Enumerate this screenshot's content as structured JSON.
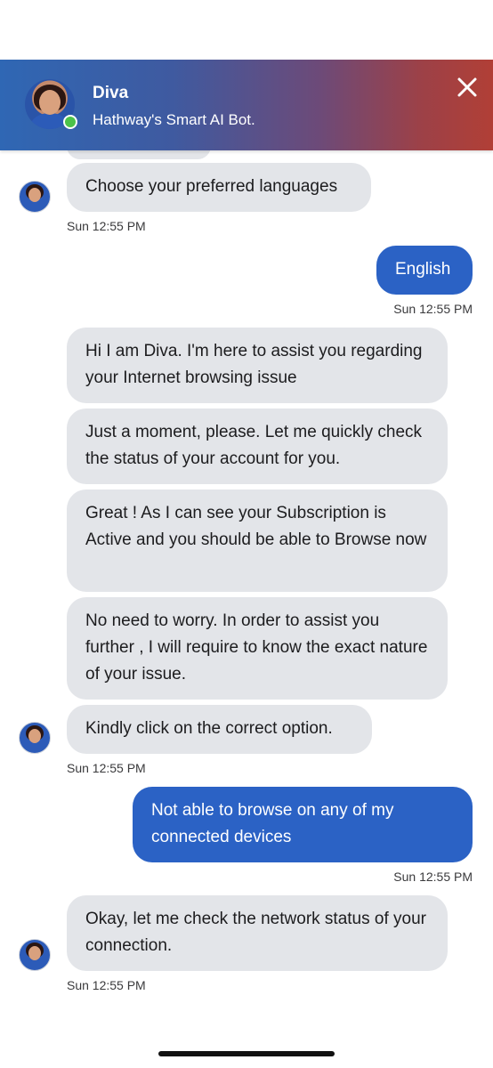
{
  "header": {
    "bot_name": "Diva",
    "subtitle": "Hathway's Smart AI Bot.",
    "close_icon": "close-icon",
    "gradient_start": "#2f67b4",
    "gradient_end": "#b13f36"
  },
  "messages": [
    {
      "sender": "bot",
      "text": "Choose your preferred languages"
    },
    {
      "sender": "user",
      "text": "English"
    },
    {
      "sender": "bot",
      "text": "Hi I am Diva. I'm here to assist you regarding your Internet browsing issue"
    },
    {
      "sender": "bot",
      "text": "Just a moment, please. Let me quickly check the status of your account for you."
    },
    {
      "sender": "bot",
      "text": "Great ! As I can see your Subscription is Active and you should be able to Browse now"
    },
    {
      "sender": "bot",
      "text": "No need to worry. In order to assist you further , I will require to know the exact nature of your issue."
    },
    {
      "sender": "bot",
      "text": "Kindly click on the correct option."
    },
    {
      "sender": "user",
      "text": "Not able to browse on any of my connected devices"
    },
    {
      "sender": "bot",
      "text": "Okay, let me check the network status of your connection."
    }
  ],
  "timestamps": [
    "Sun 12:55 PM",
    "Sun 12:55 PM",
    "Sun 12:55 PM",
    "Sun 12:55 PM",
    "Sun 12:55 PM"
  ],
  "colors": {
    "bot_bubble": "#e3e5e9",
    "user_bubble": "#2b62c5",
    "online_status": "#4cc24a"
  }
}
